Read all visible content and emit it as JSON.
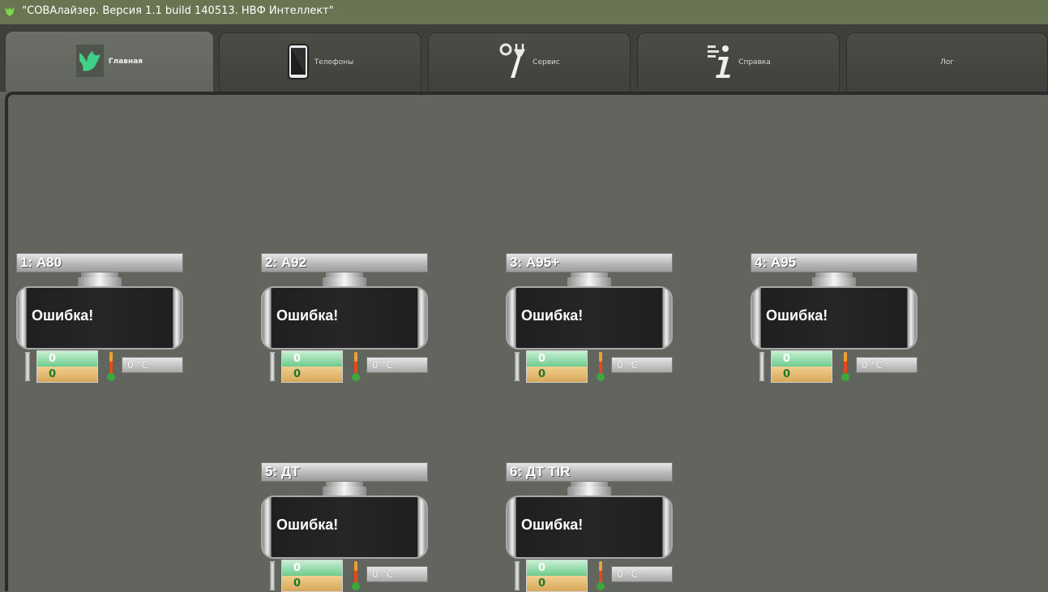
{
  "window": {
    "title": "\"СОВАлайзер. Версия 1.1 build 140513. НВФ Интеллект\""
  },
  "tabs": [
    {
      "label": "Главная",
      "icon": "owl-icon",
      "active": true
    },
    {
      "label": "Телефоны",
      "icon": "tablet-icon",
      "active": false
    },
    {
      "label": "Сервис",
      "icon": "tools-icon",
      "active": false
    },
    {
      "label": "Справка",
      "icon": "info-icon",
      "active": false
    },
    {
      "label": "Лог",
      "icon": "",
      "active": false
    }
  ],
  "tanks": [
    {
      "name": "1: А80",
      "status": "Ошибка!",
      "level_top": "0",
      "level_bottom": "0",
      "temperature": "0 °C"
    },
    {
      "name": "2: А92",
      "status": "Ошибка!",
      "level_top": "0",
      "level_bottom": "0",
      "temperature": "0 °C"
    },
    {
      "name": "3: А95+",
      "status": "Ошибка!",
      "level_top": "0",
      "level_bottom": "0",
      "temperature": "0 °C"
    },
    {
      "name": "4: А95",
      "status": "Ошибка!",
      "level_top": "0",
      "level_bottom": "0",
      "temperature": "0 °C"
    },
    {
      "name": "5: ДТ",
      "status": "Ошибка!",
      "level_top": "0",
      "level_bottom": "0",
      "temperature": "0 °C"
    },
    {
      "name": "6: ДТ TIR",
      "status": "Ошибка!",
      "level_top": "0",
      "level_bottom": "0",
      "temperature": "0 °C"
    }
  ],
  "colors": {
    "titlebar": "#697452",
    "background": "#62645e",
    "tab_active": "#6c6f67",
    "level_water": "#6dcb8d",
    "level_fuel": "#d8a85a"
  }
}
